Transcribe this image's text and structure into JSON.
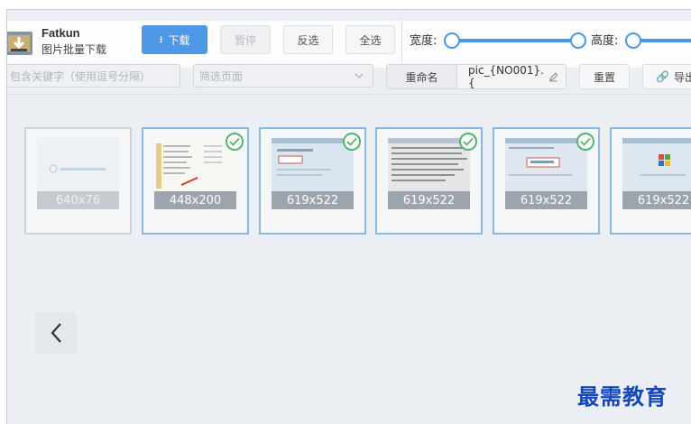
{
  "app": {
    "name": "Fatkun",
    "subtitle": "图片批量下载"
  },
  "toolbar": {
    "download_label": "下载",
    "pause_label": "暂停",
    "invert_label": "反选",
    "select_all_label": "全选",
    "width_label": "宽度:",
    "height_label": "高度:"
  },
  "filter": {
    "keyword_placeholder": "包含关键字（使用逗号分隔)",
    "page_select_placeholder": "筛选页面",
    "rename_label": "重命名",
    "rename_pattern": "pic_{NO001}.{",
    "reset_label": "重置",
    "export_label": "导出"
  },
  "images": [
    {
      "size": "640x76",
      "selected": false
    },
    {
      "size": "448x200",
      "selected": true
    },
    {
      "size": "619x522",
      "selected": true
    },
    {
      "size": "619x522",
      "selected": true
    },
    {
      "size": "619x522",
      "selected": true
    },
    {
      "size": "619x522",
      "selected": false
    }
  ],
  "watermark": "最需教育",
  "colors": {
    "accent": "#4291e8",
    "check": "#55b36b",
    "selected_border": "#8ab8e2"
  }
}
